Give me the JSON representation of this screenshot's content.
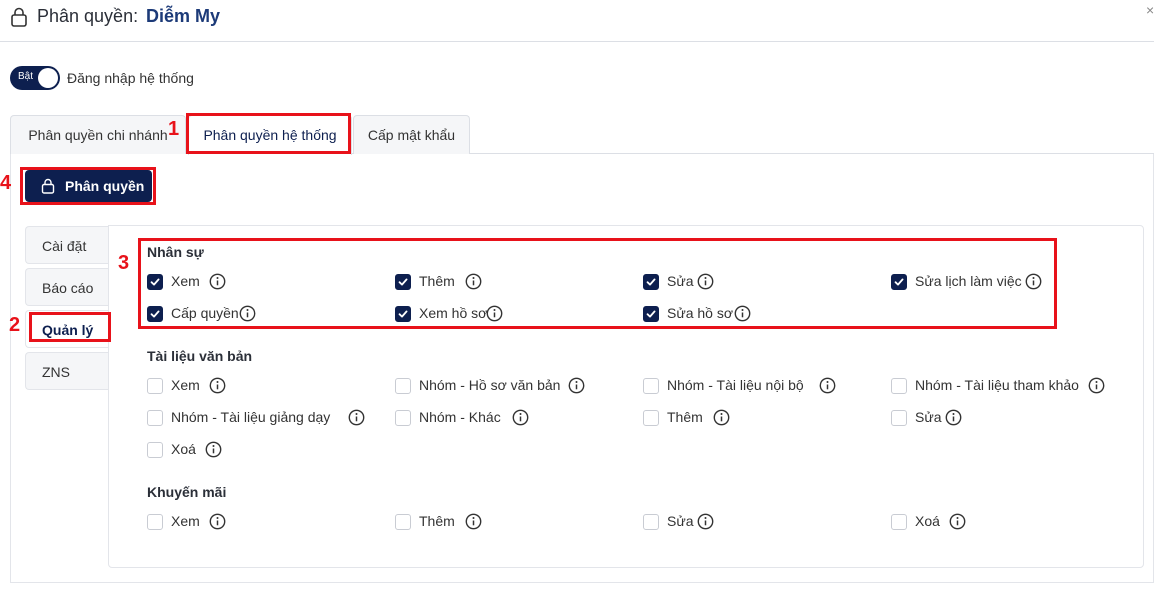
{
  "header": {
    "title": "Phân quyền:",
    "name": "Diễm My",
    "close": "×"
  },
  "login_toggle": {
    "state_label": "Bật",
    "label": "Đăng nhập hệ thống",
    "on": true
  },
  "tabs": [
    {
      "label": "Phân quyền chi nhánh",
      "active": false
    },
    {
      "label": "Phân quyền hệ thống",
      "active": true
    },
    {
      "label": "Cấp mật khẩu",
      "active": false
    }
  ],
  "permission_button": {
    "label": "Phân quyền",
    "icon": "lock-icon"
  },
  "sidebar": [
    {
      "label": "Cài đặt",
      "active": false
    },
    {
      "label": "Báo cáo",
      "active": false
    },
    {
      "label": "Quản lý",
      "active": true
    },
    {
      "label": "ZNS",
      "active": false
    }
  ],
  "sections": [
    {
      "title": "Nhân sự",
      "items": [
        {
          "label": "Xem",
          "checked": true
        },
        {
          "label": "Thêm",
          "checked": true
        },
        {
          "label": "Sửa",
          "checked": true
        },
        {
          "label": "Sửa lịch làm việc",
          "checked": true
        },
        {
          "label": "Cấp quyền",
          "checked": true
        },
        {
          "label": "Xem hồ sơ",
          "checked": true
        },
        {
          "label": "Sửa hồ sơ",
          "checked": true
        }
      ]
    },
    {
      "title": "Tài liệu văn bản",
      "items": [
        {
          "label": "Xem",
          "checked": false
        },
        {
          "label": "Nhóm - Hồ sơ văn bản",
          "checked": false
        },
        {
          "label": "Nhóm - Tài liệu nội bộ",
          "checked": false
        },
        {
          "label": "Nhóm - Tài liệu tham khảo",
          "checked": false
        },
        {
          "label": "Nhóm - Tài liệu giảng dạy",
          "checked": false
        },
        {
          "label": "Nhóm - Khác",
          "checked": false
        },
        {
          "label": "Thêm",
          "checked": false
        },
        {
          "label": "Sửa",
          "checked": false
        },
        {
          "label": "Xoá",
          "checked": false
        }
      ]
    },
    {
      "title": "Khuyến mãi",
      "items": [
        {
          "label": "Xem",
          "checked": false
        },
        {
          "label": "Thêm",
          "checked": false
        },
        {
          "label": "Sửa",
          "checked": false
        },
        {
          "label": "Xoá",
          "checked": false
        }
      ]
    }
  ],
  "annotations": [
    "1",
    "2",
    "3",
    "4"
  ],
  "colors": {
    "primary": "#0d1f4f",
    "annotation": "#e8121a",
    "border": "#dcdfe5"
  }
}
